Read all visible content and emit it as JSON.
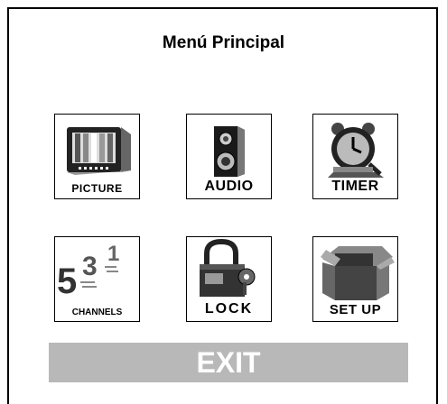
{
  "menu": {
    "title": "Menú Principal",
    "items": [
      {
        "label": "PICTURE",
        "icon": "tv-icon"
      },
      {
        "label": "AUDIO",
        "icon": "speaker-icon"
      },
      {
        "label": "TIMER",
        "icon": "alarm-clock-icon"
      },
      {
        "label": "CHANNELS",
        "icon": "channel-numbers-icon"
      },
      {
        "label": "LOCK",
        "icon": "padlock-icon"
      },
      {
        "label": "SET UP",
        "icon": "open-box-icon"
      }
    ],
    "exit_label": "EXIT"
  }
}
